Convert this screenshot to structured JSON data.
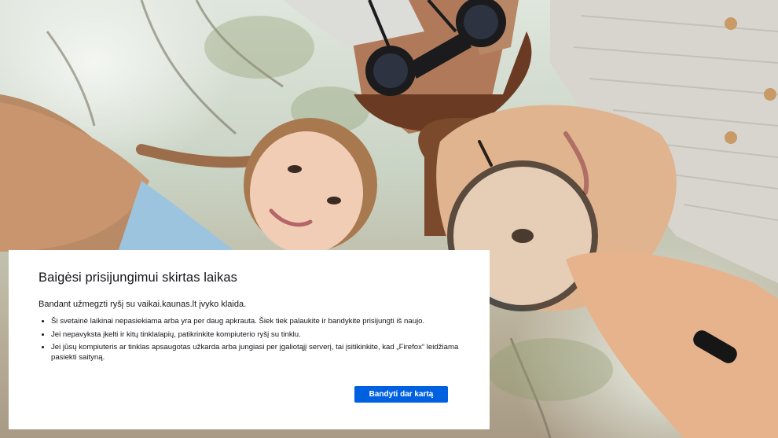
{
  "error_page": {
    "title": "Baigėsi prisijungimui skirtas laikas",
    "description": "Bandant užmegzti ryšį su vaikai.kaunas.lt įvyko klaida.",
    "bullets": [
      "Ši svetainė laikinai nepasiekiama arba yra per daug apkrauta. Šiek tiek palaukite ir bandykite prisijungti iš naujo.",
      "Jei nepavyksta įkelti ir kitų tinklalapių, patikrinkite kompiuterio ryšį su tinklu.",
      "Jei jūsų kompiuteris ar tinklas apsaugotas užkarda arba jungiasi per įgaliotąjį serverį, tai įsitikinkite, kad „Firefox“ leidžiama pasiekti saityną."
    ],
    "retry_label": "Bandyti dar kartą",
    "accent_color": "#0061e0"
  },
  "background": {
    "subject": "children-with-binoculars-and-magnifying-glass-photo"
  }
}
